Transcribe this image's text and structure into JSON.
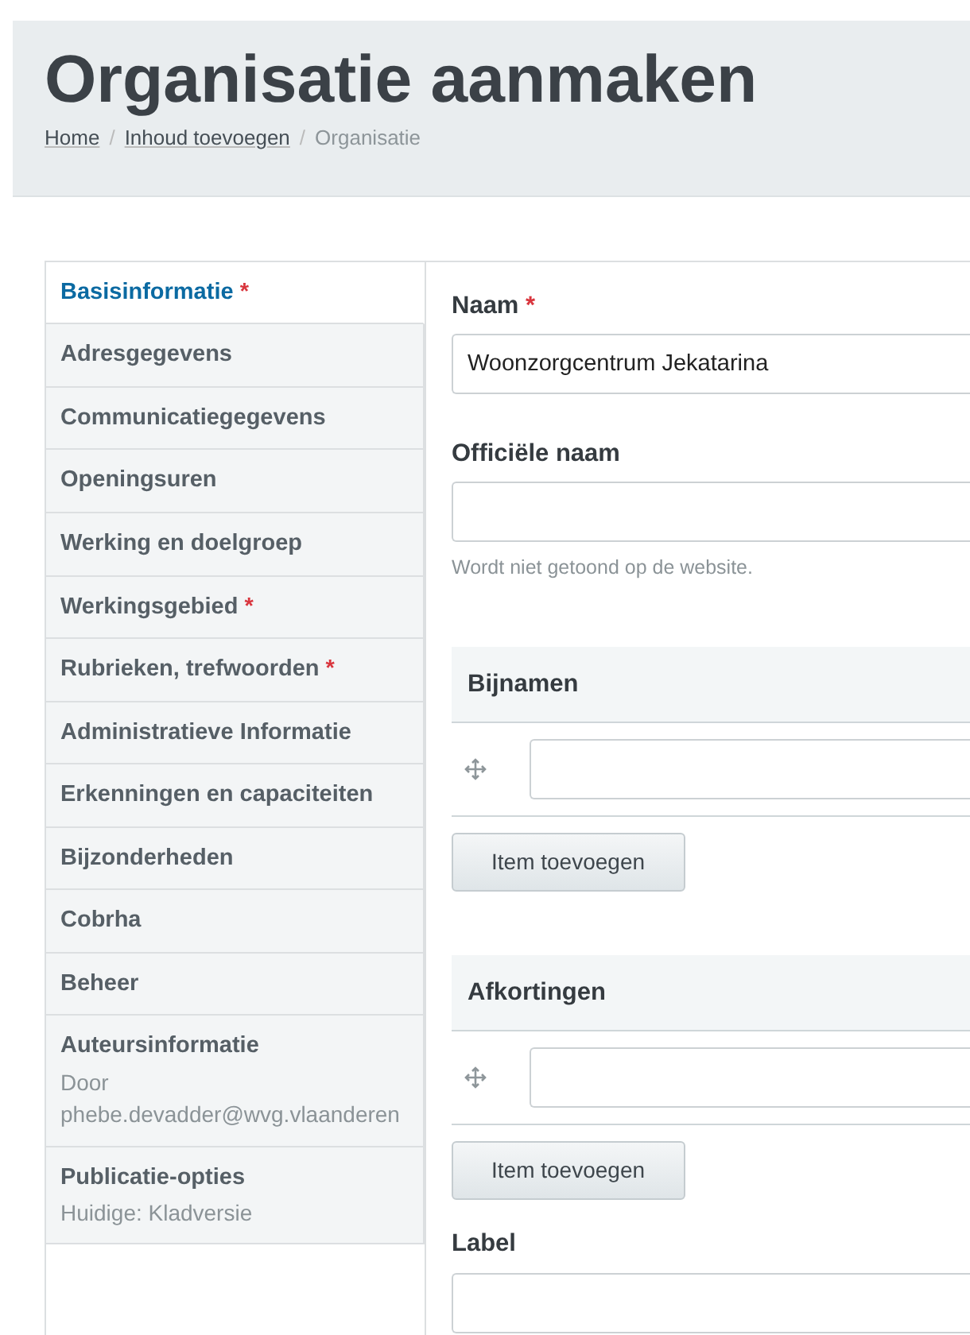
{
  "header": {
    "title": "Organisatie aanmaken",
    "breadcrumb": [
      {
        "label": "Home",
        "link": true
      },
      {
        "separator": "/",
        "label": "Inhoud toevoegen",
        "link": true
      },
      {
        "separator": "/",
        "label": "Organisatie",
        "link": false
      }
    ]
  },
  "sidebar": {
    "items": [
      {
        "label": "Basisinformatie",
        "required_mark": "*",
        "selected": true
      },
      {
        "label": "Adresgegevens",
        "selected": false
      },
      {
        "label": "Communicatiegegevens",
        "selected": false
      },
      {
        "label": "Openingsuren",
        "selected": false
      },
      {
        "label": "Werking en doelgroep",
        "selected": false
      },
      {
        "label": "Werkingsgebied",
        "required_mark": "*",
        "selected": false
      },
      {
        "label": "Rubrieken, trefwoorden",
        "required_mark": "*",
        "selected": false
      },
      {
        "label": "Administratieve Informatie",
        "selected": false
      },
      {
        "label": "Erkenningen en capaciteiten",
        "selected": false
      },
      {
        "label": "Bijzonderheden",
        "selected": false
      },
      {
        "label": "Cobrha",
        "selected": false
      },
      {
        "label": "Beheer",
        "selected": false
      },
      {
        "label": "Auteursinformatie",
        "selected": false,
        "summary": "Door phebe.devadder@wvg.vlaanderen"
      },
      {
        "label": "Publicatie-opties",
        "selected": false,
        "summary": "Huidige: Kladversie"
      }
    ]
  },
  "form": [
    {
      "kind": "text",
      "label": "Naam",
      "required_mark": "*",
      "value": "Woonzorgcentrum Jekatarina"
    },
    {
      "kind": "text",
      "label": "Officiële naam",
      "description": "Wordt niet getoond op de website."
    },
    {
      "kind": "multi",
      "title": "Bijnamen",
      "button": "Item toevoegen"
    },
    {
      "kind": "multi",
      "title": "Afkortingen",
      "button": "Item toevoegen"
    },
    {
      "kind": "text",
      "label": "Label"
    }
  ]
}
